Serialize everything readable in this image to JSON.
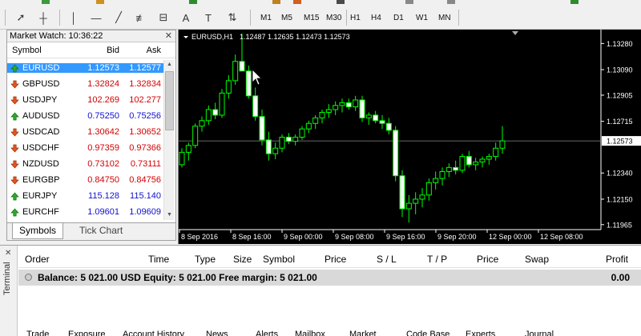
{
  "market_watch": {
    "title": "Market Watch: 10:36:22",
    "headers": {
      "symbol": "Symbol",
      "bid": "Bid",
      "ask": "Ask"
    },
    "rows": [
      {
        "symbol": "EURUSD",
        "bid": "1.12573",
        "ask": "1.12577",
        "dir": "up",
        "selected": true,
        "color": "#ffffff"
      },
      {
        "symbol": "GBPUSD",
        "bid": "1.32824",
        "ask": "1.32834",
        "dir": "down",
        "color": "#d40000"
      },
      {
        "symbol": "USDJPY",
        "bid": "102.269",
        "ask": "102.277",
        "dir": "down",
        "color": "#d40000"
      },
      {
        "symbol": "AUDUSD",
        "bid": "0.75250",
        "ask": "0.75256",
        "dir": "up",
        "color": "#1010d0"
      },
      {
        "symbol": "USDCAD",
        "bid": "1.30642",
        "ask": "1.30652",
        "dir": "down",
        "color": "#d40000"
      },
      {
        "symbol": "USDCHF",
        "bid": "0.97359",
        "ask": "0.97366",
        "dir": "down",
        "color": "#d40000"
      },
      {
        "symbol": "NZDUSD",
        "bid": "0.73102",
        "ask": "0.73111",
        "dir": "down",
        "color": "#d40000"
      },
      {
        "symbol": "EURGBP",
        "bid": "0.84750",
        "ask": "0.84756",
        "dir": "down",
        "color": "#d40000"
      },
      {
        "symbol": "EURJPY",
        "bid": "115.128",
        "ask": "115.140",
        "dir": "up",
        "color": "#1010d0"
      },
      {
        "symbol": "EURCHF",
        "bid": "1.09601",
        "ask": "1.09609",
        "dir": "up",
        "color": "#1010d0"
      }
    ],
    "tabs": [
      "Symbols",
      "Tick Chart"
    ]
  },
  "toolbar": {
    "tools": [
      {
        "name": "cursor-icon",
        "glyph": "➚"
      },
      {
        "name": "crosshair-icon",
        "glyph": "┼"
      },
      {
        "name": "vertical-line-icon",
        "glyph": "│"
      },
      {
        "name": "horizontal-line-icon",
        "glyph": "—"
      },
      {
        "name": "trendline-icon",
        "glyph": "╱"
      },
      {
        "name": "fibo-icon",
        "glyph": "≢"
      },
      {
        "name": "channel-icon",
        "glyph": "⊟"
      },
      {
        "name": "text-icon",
        "glyph": "A"
      },
      {
        "name": "text-label-icon",
        "glyph": "T"
      },
      {
        "name": "arrows-icon",
        "glyph": "⇅"
      }
    ],
    "timeframes": [
      "M1",
      "M5",
      "M15",
      "M30",
      "H1",
      "H4",
      "D1",
      "W1",
      "MN"
    ],
    "active_timeframe": "H1"
  },
  "chart_data": {
    "type": "candlestick",
    "title": "EURUSD,H1",
    "ohlc_label": "1.12487 1.12635 1.12473 1.12573",
    "ylim": [
      1.11929,
      1.13346
    ],
    "y_ticks": [
      "1.13280",
      "1.13090",
      "1.12905",
      "1.12715",
      "1.12573",
      "1.12340",
      "1.12150",
      "1.11965"
    ],
    "current_price": "1.12573",
    "x_ticks": [
      "8 Sep 2016",
      "8 Sep 16:00",
      "9 Sep 00:00",
      "9 Sep 08:00",
      "9 Sep 16:00",
      "9 Sep 20:00",
      "12 Sep 00:00",
      "12 Sep 08:00"
    ],
    "candles": [
      [
        1.124,
        1.1252,
        1.1238,
        1.1249
      ],
      [
        1.1249,
        1.1256,
        1.1243,
        1.1254
      ],
      [
        1.1254,
        1.127,
        1.1252,
        1.1268
      ],
      [
        1.1268,
        1.1275,
        1.1264,
        1.1272
      ],
      [
        1.1272,
        1.1283,
        1.1269,
        1.128
      ],
      [
        1.128,
        1.1285,
        1.1273,
        1.1276
      ],
      [
        1.1276,
        1.1295,
        1.1274,
        1.1292
      ],
      [
        1.1292,
        1.1305,
        1.1288,
        1.1301
      ],
      [
        1.1301,
        1.132,
        1.1298,
        1.1315
      ],
      [
        1.1315,
        1.1335,
        1.131,
        1.1308
      ],
      [
        1.1308,
        1.1312,
        1.1288,
        1.129
      ],
      [
        1.129,
        1.1296,
        1.1272,
        1.1275
      ],
      [
        1.1275,
        1.128,
        1.1254,
        1.1258
      ],
      [
        1.1258,
        1.1264,
        1.1243,
        1.1248
      ],
      [
        1.1248,
        1.1256,
        1.1244,
        1.1252
      ],
      [
        1.1252,
        1.1262,
        1.1249,
        1.126
      ],
      [
        1.126,
        1.1263,
        1.1255,
        1.1257
      ],
      [
        1.1257,
        1.1262,
        1.1254,
        1.126
      ],
      [
        1.126,
        1.1268,
        1.1258,
        1.1266
      ],
      [
        1.1266,
        1.1272,
        1.1263,
        1.127
      ],
      [
        1.127,
        1.1276,
        1.1266,
        1.1274
      ],
      [
        1.1274,
        1.128,
        1.127,
        1.1278
      ],
      [
        1.1278,
        1.1284,
        1.1274,
        1.128
      ],
      [
        1.128,
        1.1286,
        1.1276,
        1.1283
      ],
      [
        1.1283,
        1.1288,
        1.1278,
        1.1285
      ],
      [
        1.1285,
        1.1288,
        1.128,
        1.1282
      ],
      [
        1.1282,
        1.129,
        1.1279,
        1.1287
      ],
      [
        1.1287,
        1.129,
        1.1271,
        1.1274
      ],
      [
        1.1274,
        1.1278,
        1.1269,
        1.1276
      ],
      [
        1.1276,
        1.1279,
        1.127,
        1.1272
      ],
      [
        1.1272,
        1.1276,
        1.1266,
        1.127
      ],
      [
        1.127,
        1.1274,
        1.1262,
        1.1265
      ],
      [
        1.1265,
        1.1268,
        1.1228,
        1.1232
      ],
      [
        1.1232,
        1.1236,
        1.1202,
        1.1208
      ],
      [
        1.1208,
        1.1218,
        1.1198,
        1.1212
      ],
      [
        1.1212,
        1.122,
        1.1204,
        1.1215
      ],
      [
        1.1215,
        1.1223,
        1.1209,
        1.1218
      ],
      [
        1.1218,
        1.123,
        1.1214,
        1.1227
      ],
      [
        1.1227,
        1.1235,
        1.1222,
        1.123
      ],
      [
        1.123,
        1.1238,
        1.1225,
        1.1235
      ],
      [
        1.1235,
        1.1241,
        1.1231,
        1.1238
      ],
      [
        1.1238,
        1.1243,
        1.1233,
        1.1236
      ],
      [
        1.1236,
        1.1248,
        1.1234,
        1.1246
      ],
      [
        1.1246,
        1.125,
        1.1238,
        1.124
      ],
      [
        1.124,
        1.1245,
        1.1236,
        1.1242
      ],
      [
        1.1242,
        1.1246,
        1.1238,
        1.1244
      ],
      [
        1.1244,
        1.1248,
        1.124,
        1.1246
      ],
      [
        1.1246,
        1.1256,
        1.1243,
        1.1252
      ],
      [
        1.1252,
        1.1268,
        1.1248,
        1.12573
      ]
    ]
  },
  "terminal": {
    "side_label": "Terminal",
    "headers": [
      "Order",
      "Time",
      "Type",
      "Size",
      "Symbol",
      "Price",
      "S / L",
      "T / P",
      "Price",
      "Swap",
      "Profit"
    ],
    "balance_text": "Balance: 5 021.00 USD  Equity: 5 021.00  Free margin: 5 021.00",
    "profit": "0.00",
    "tabs": [
      "Trade",
      "Exposure",
      "Account History",
      "News",
      "Alerts",
      "Mailbox",
      "Market",
      "Code Base",
      "Experts",
      "Journal"
    ]
  }
}
